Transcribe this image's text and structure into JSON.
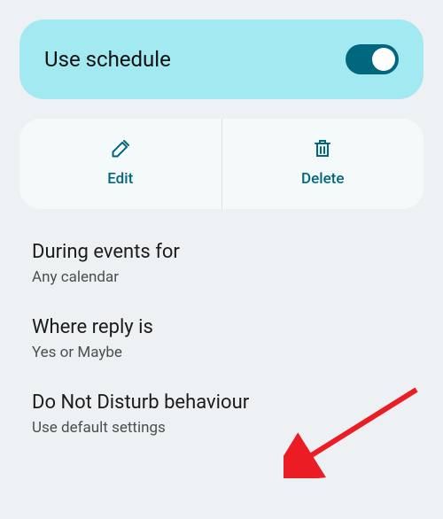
{
  "schedule_toggle": {
    "label": "Use schedule",
    "enabled": true
  },
  "actions": {
    "edit": {
      "label": "Edit",
      "icon": "pencil-icon"
    },
    "delete": {
      "label": "Delete",
      "icon": "trash-icon"
    }
  },
  "settings": [
    {
      "title": "During events for",
      "subtitle": "Any calendar"
    },
    {
      "title": "Where reply is",
      "subtitle": "Yes or Maybe"
    },
    {
      "title": "Do Not Disturb behaviour",
      "subtitle": "Use default settings"
    }
  ]
}
